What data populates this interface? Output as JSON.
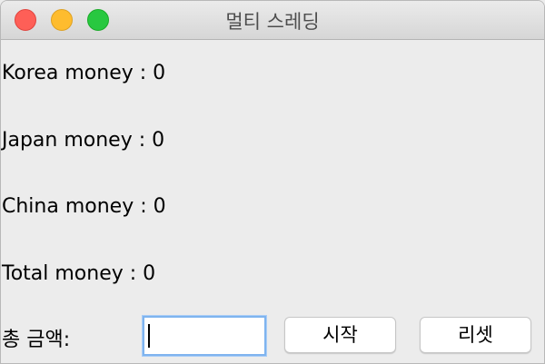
{
  "window": {
    "title": "멀티 스레딩"
  },
  "money": {
    "korea": {
      "label": "Korea money : ",
      "value": "0"
    },
    "japan": {
      "label": "Japan money : ",
      "value": "0"
    },
    "china": {
      "label": "China money : ",
      "value": "0"
    },
    "total": {
      "label": "Total money : ",
      "value": "0"
    }
  },
  "controls": {
    "amount_label": "총 금액:",
    "amount_value": "",
    "start_label": "시작",
    "reset_label": "리셋"
  },
  "colors": {
    "close": "#fe5f57",
    "minimize": "#febc2e",
    "zoom": "#28c840",
    "focus_ring": "#7fb4ef"
  }
}
